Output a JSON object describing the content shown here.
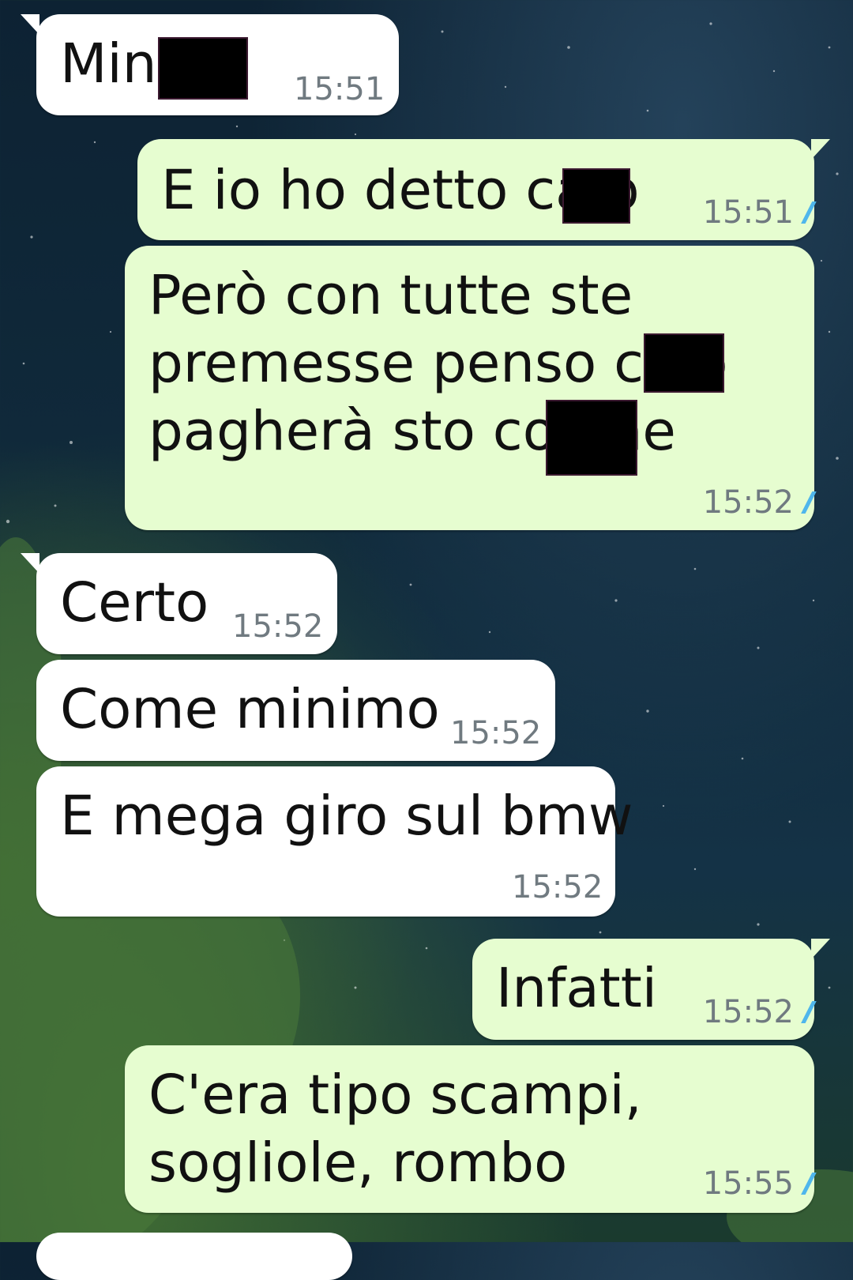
{
  "messages": [
    {
      "id": "m1",
      "direction": "incoming",
      "text": "Min a",
      "time": "15:51"
    },
    {
      "id": "m2",
      "direction": "outgoing",
      "text": "E io ho detto ca o",
      "time": "15:51",
      "status": "read"
    },
    {
      "id": "m3",
      "direction": "outgoing",
      "lines": [
        "Però con tutte ste",
        "premesse penso ca o",
        "pagherà sto cog he"
      ],
      "time": "15:52",
      "status": "read"
    },
    {
      "id": "m4",
      "direction": "incoming",
      "text": "Certo",
      "time": "15:52"
    },
    {
      "id": "m5",
      "direction": "incoming",
      "text": "Come minimo",
      "time": "15:52"
    },
    {
      "id": "m6",
      "direction": "incoming",
      "text": "E mega giro sul bmw",
      "time": "15:52"
    },
    {
      "id": "m7",
      "direction": "outgoing",
      "text": "Infatti",
      "time": "15:52",
      "status": "read"
    },
    {
      "id": "m8",
      "direction": "outgoing",
      "lines": [
        "C'era tipo scampi,",
        "sogliole, rombo"
      ],
      "time": "15:55",
      "status": "read"
    }
  ],
  "colors": {
    "incoming_bubble": "#ffffff",
    "outgoing_bubble": "#e6fdd0",
    "timestamp": "#707a80",
    "read_ticks": "#4fb6ec"
  },
  "icons": {
    "read_receipt": "double-check-icon"
  }
}
